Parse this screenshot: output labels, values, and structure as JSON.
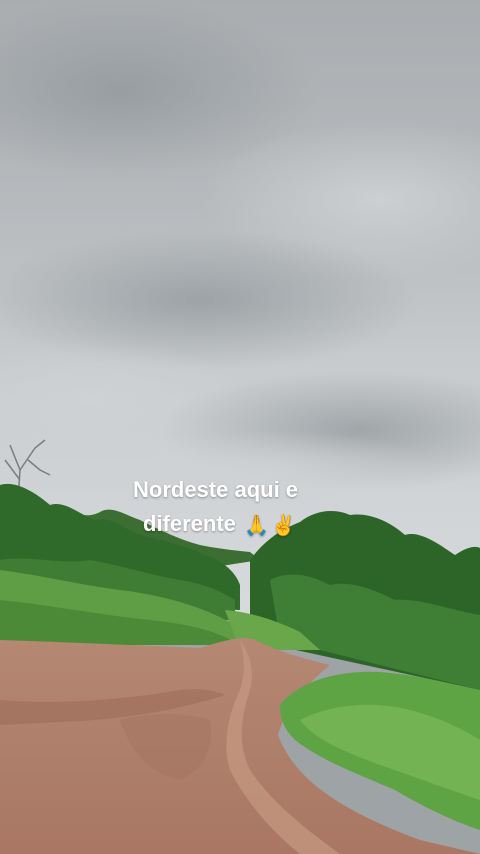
{
  "caption": {
    "line1": "Nordeste aqui e",
    "line2": "diferente",
    "emoji_pray": "🙏",
    "emoji_peace": "✌️"
  },
  "colors": {
    "sky_top": "#a3a8ab",
    "sky_mid": "#c4c8cb",
    "sky_horizon": "#d9dcde",
    "vegetation_dark": "#2f6b2b",
    "vegetation_light": "#5a9a3e",
    "grass": "#6fae48",
    "dirt": "#b98a72",
    "dirt_dark": "#9d6f5a",
    "caption_text": "#ffffff"
  }
}
